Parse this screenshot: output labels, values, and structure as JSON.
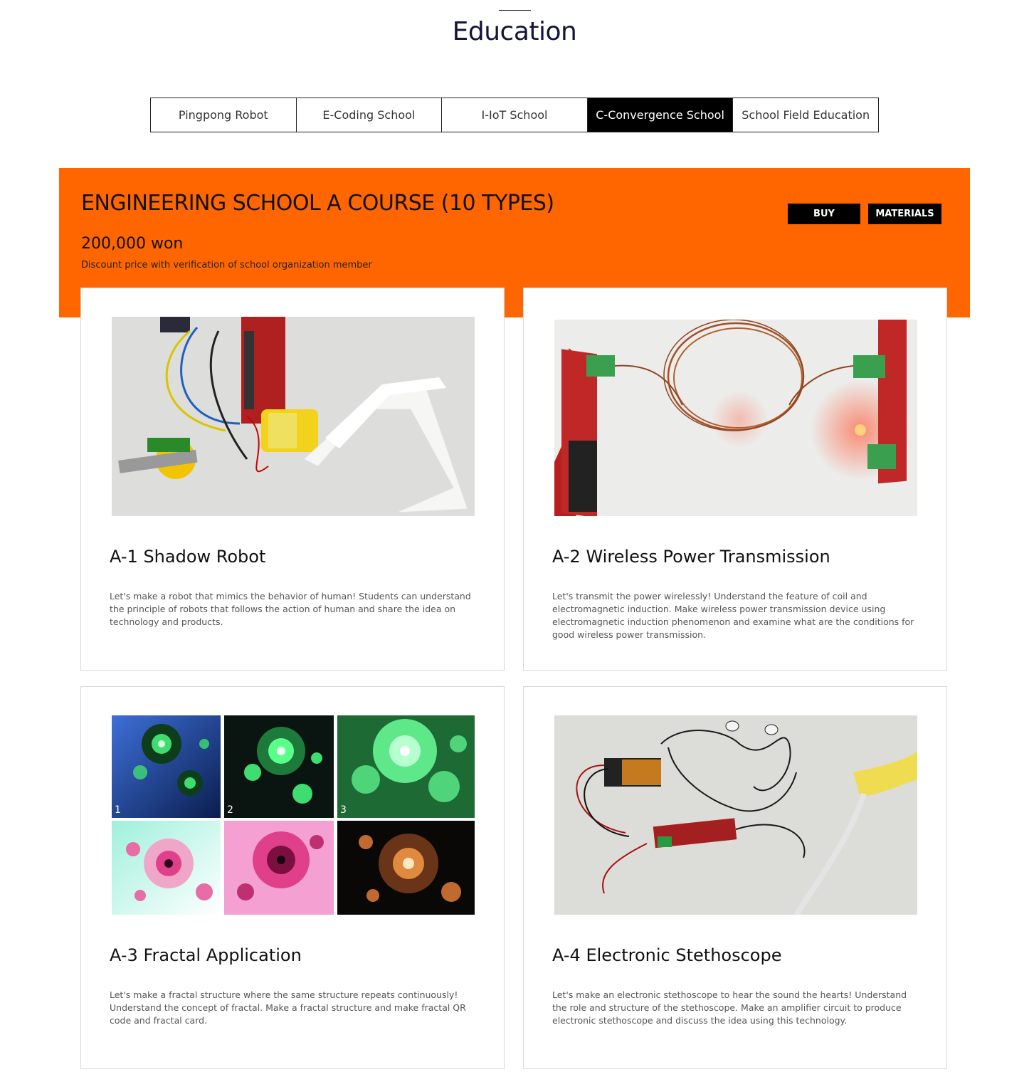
{
  "page": {
    "title": "Education"
  },
  "tabs": [
    {
      "label": "Pingpong Robot",
      "active": false
    },
    {
      "label": "E-Coding School",
      "active": false
    },
    {
      "label": "I-IoT School",
      "active": false
    },
    {
      "label": "C-Convergence School",
      "active": true
    },
    {
      "label": "School Field Education",
      "active": false
    }
  ],
  "course": {
    "title_main": "ENGINEERING SCHOOL A COURSE",
    "title_types": "(10 TYPES)",
    "price": "200,000 won",
    "discount_note": "Discount price with verification of school organization member",
    "buy_label": "BUY",
    "materials_label": "MATERIALS",
    "accent_color": "#ff6600"
  },
  "cards": [
    {
      "title": "A-1 Shadow Robot",
      "description": "Let's make a robot that mimics the behavior of human! Students can understand the principle of robots that follows the action of human and share the idea on technology and products."
    },
    {
      "title": "A-2 Wireless Power Transmission",
      "description": "Let's transmit the power wirelessly! Understand the feature of coil and electromagnetic induction. Make wireless power transmission device using electromagnetic induction phenomenon and examine what are the conditions for good wireless power transmission."
    },
    {
      "title": "A-3 Fractal Application",
      "description": "Let's make a fractal structure where the same structure repeats continuously! Understand the concept of fractal. Make a fractal structure and make fractal QR code and fractal card.",
      "panel_numbers": [
        "1",
        "2",
        "3"
      ]
    },
    {
      "title": "A-4 Electronic Stethoscope",
      "description": "Let's make an electronic stethoscope to hear the sound the hearts! Understand the role and structure of the stethoscope. Make an amplifier circuit to produce electronic stethoscope and discuss the idea using this technology."
    }
  ]
}
